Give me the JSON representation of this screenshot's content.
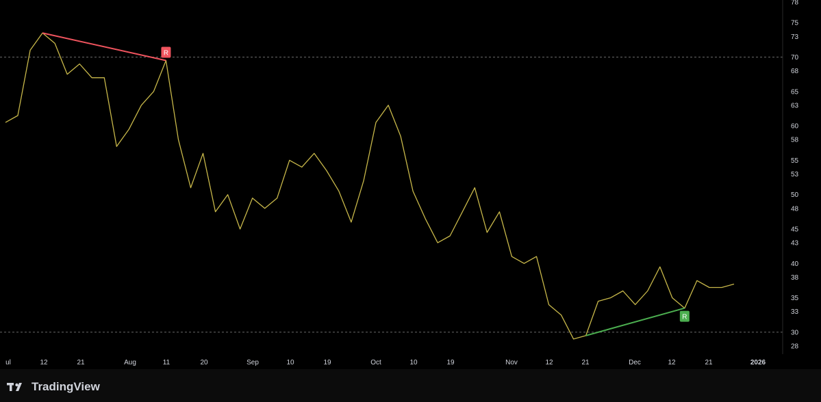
{
  "branding": {
    "name": "TradingView",
    "logo_icon": "tradingview-logo-icon"
  },
  "colors": {
    "background": "#000000",
    "line": "#c8b84a",
    "bearish": "#f0545e",
    "bullish": "#4caf50",
    "level_line": "#6b6b6b",
    "axis_text": "#d1d4dc"
  },
  "chart_data": {
    "type": "line",
    "title": "",
    "xlabel": "",
    "ylabel": "",
    "ylim": [
      27,
      78
    ],
    "y_ticks": [
      "78",
      "75",
      "73",
      "70",
      "68",
      "65",
      "63",
      "60",
      "58",
      "55",
      "53",
      "50",
      "48",
      "45",
      "43",
      "40",
      "38",
      "35",
      "33",
      "30",
      "28"
    ],
    "x_tick_labels": [
      "ul",
      "12",
      "21",
      "Aug",
      "11",
      "20",
      "Sep",
      "10",
      "19",
      "Oct",
      "10",
      "19",
      "Nov",
      "12",
      "21",
      "Dec",
      "12",
      "21",
      "2026"
    ],
    "series": [
      {
        "values": [
          60.5,
          61.5,
          71,
          73.5,
          72,
          67.5,
          69,
          67,
          67,
          57,
          59.5,
          63,
          65,
          69.5,
          58,
          51,
          56,
          47.5,
          50,
          45,
          49.5,
          48,
          49.5,
          55,
          54,
          56,
          53.5,
          50.5,
          46,
          52,
          60.5,
          63,
          58.5,
          50.5,
          46.5,
          43,
          44,
          47.5,
          51,
          44.5,
          47.5,
          41,
          40,
          41,
          34,
          32.5,
          29,
          29.5,
          34.5,
          35,
          36,
          34,
          36,
          39.5,
          35,
          33.5,
          37.5,
          36.5,
          36.5,
          37
        ]
      }
    ],
    "horizontal_levels": [
      70,
      30
    ],
    "annotations": [
      {
        "type": "bearish-divergence",
        "from_index": 3,
        "to_index": 13,
        "label": "R"
      },
      {
        "type": "bullish-divergence",
        "from_index": 47,
        "to_index": 55,
        "label": "R"
      }
    ],
    "grid": false
  }
}
